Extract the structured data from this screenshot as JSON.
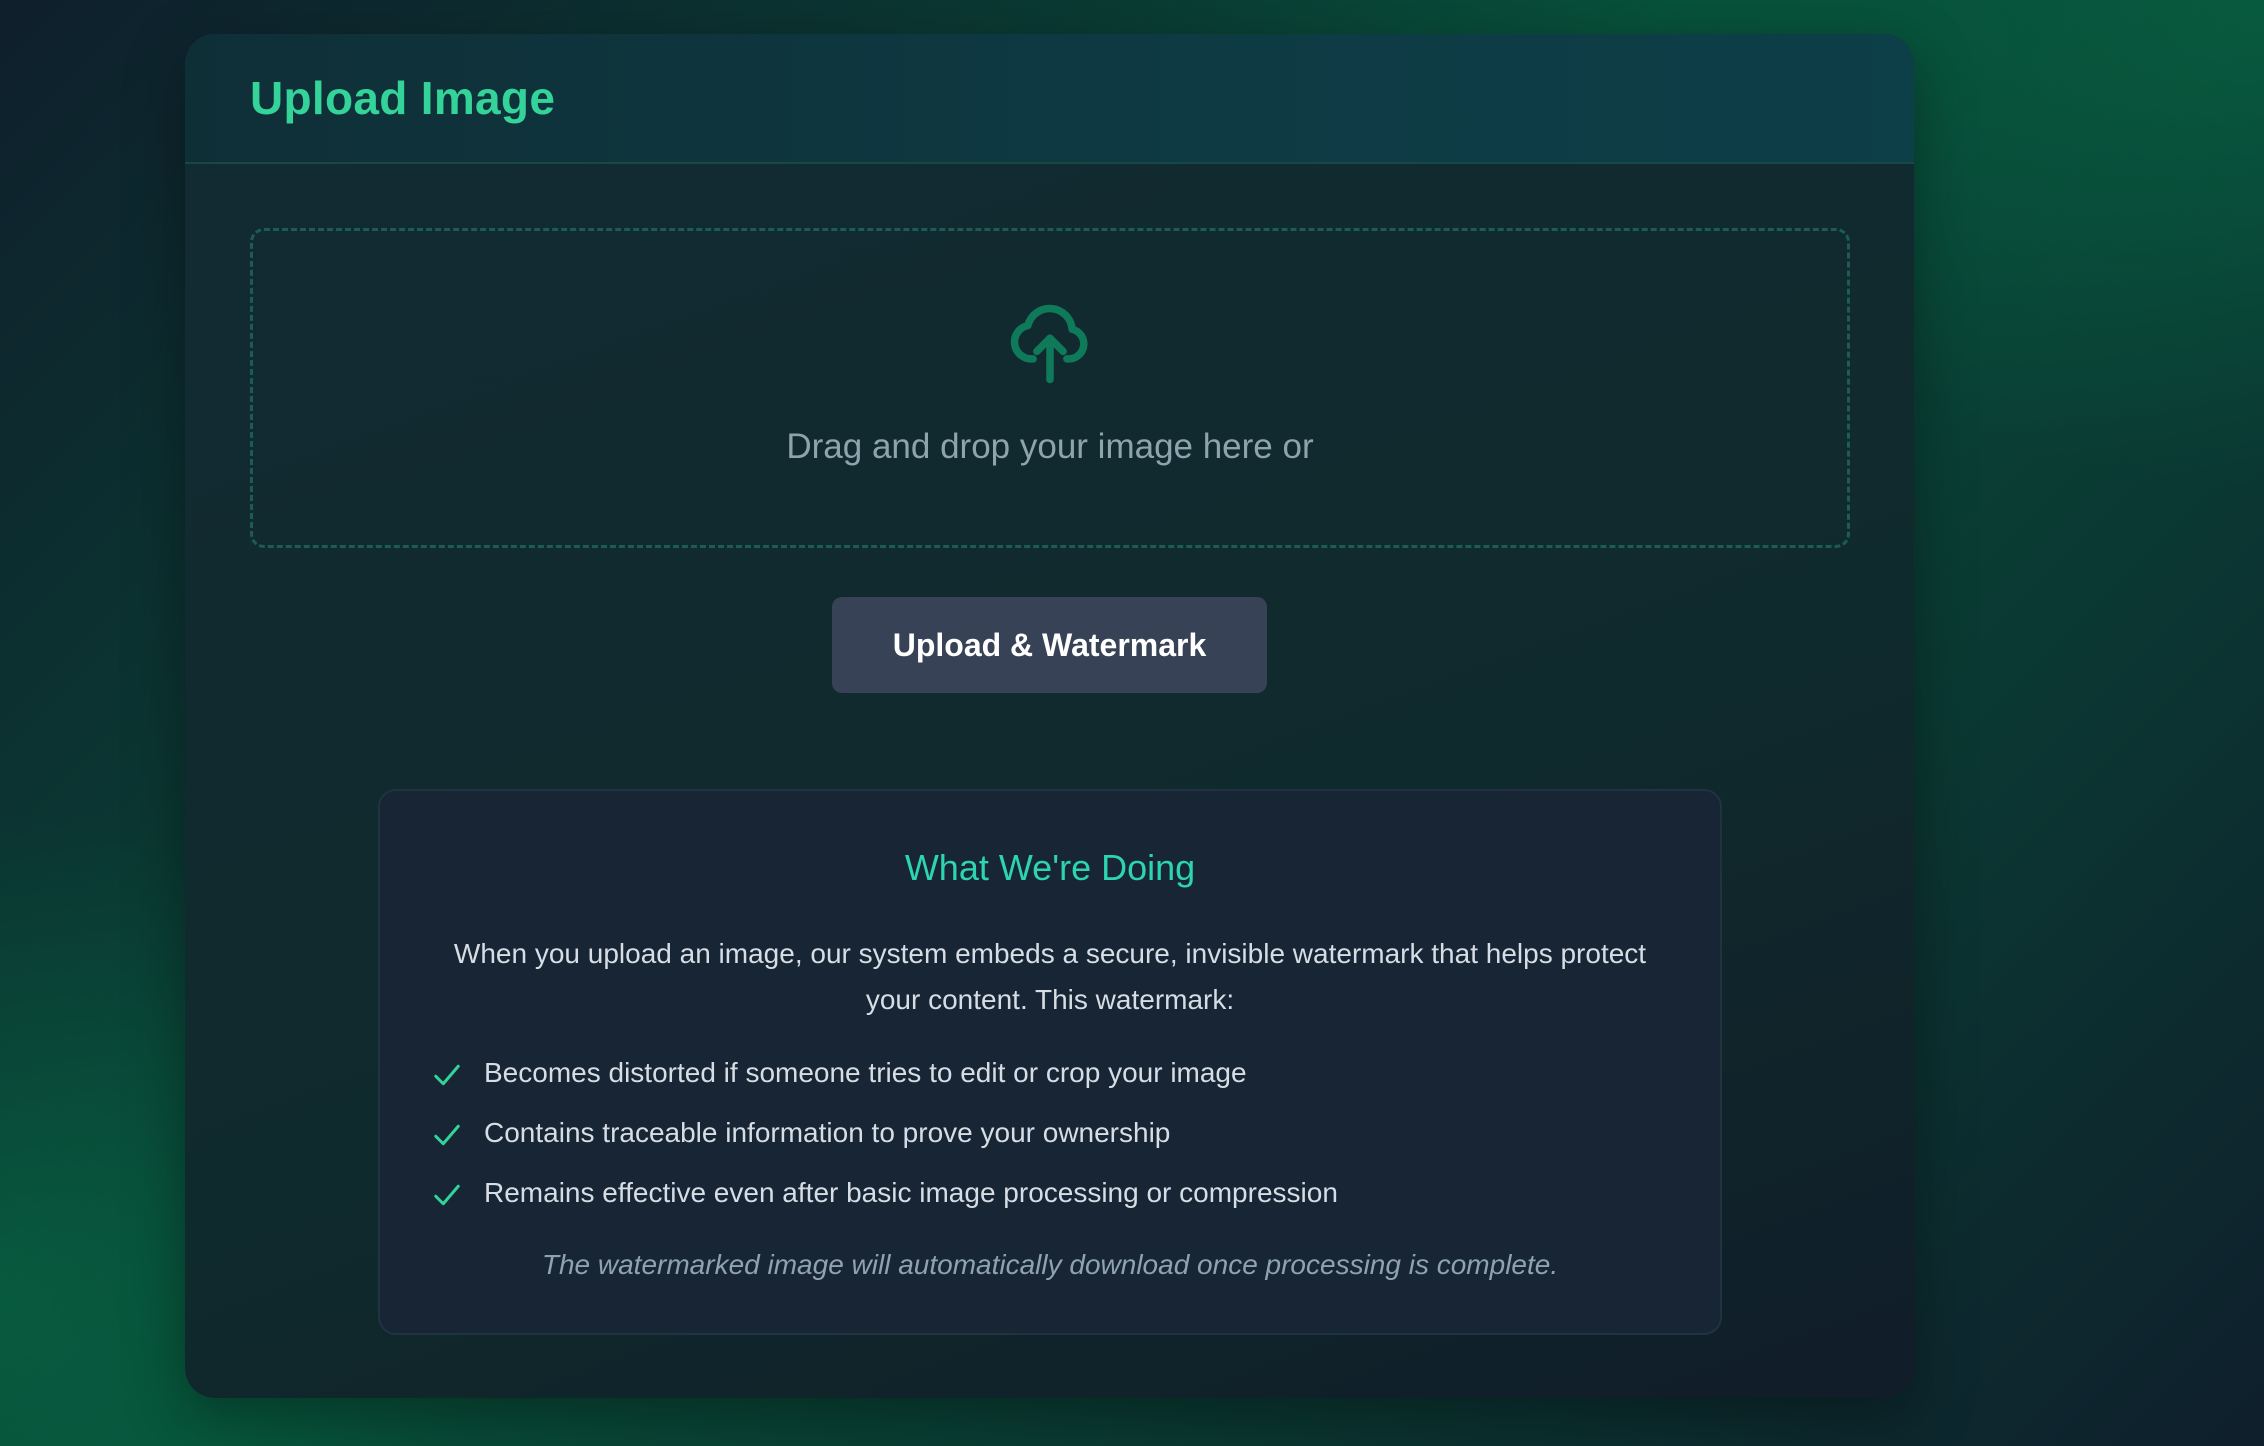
{
  "card": {
    "title": "Upload Image"
  },
  "dropzone": {
    "icon": "cloud-upload-icon",
    "text": "Drag and drop your image here or"
  },
  "actions": {
    "upload_label": "Upload & Watermark"
  },
  "info": {
    "title": "What We're Doing",
    "description": "When you upload an image, our system embeds a secure, invisible watermark that helps protect your content. This watermark:",
    "items": [
      {
        "icon": "check-icon",
        "text": "Becomes distorted if someone tries to edit or crop your image"
      },
      {
        "icon": "check-icon",
        "text": "Contains traceable information to prove your ownership"
      },
      {
        "icon": "check-icon",
        "text": "Remains effective even after basic image processing or compression"
      }
    ],
    "footnote": "The watermarked image will automatically download once processing is complete."
  },
  "colors": {
    "accent": "#34d399",
    "info_title": "#2dd4b0",
    "button_bg": "#374257",
    "icon_green": "#0e7a5a"
  }
}
